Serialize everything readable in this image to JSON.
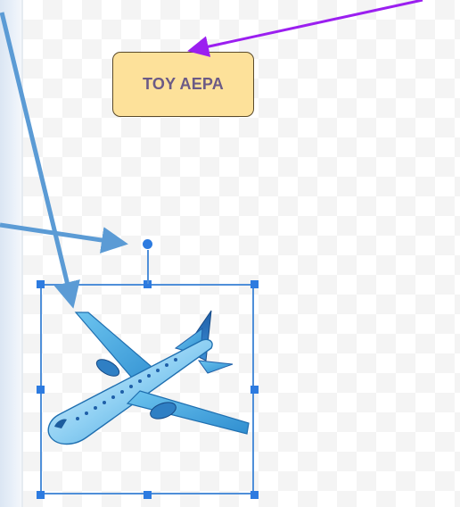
{
  "slide": {
    "label_text": "TOY AEPA"
  },
  "image": {
    "icon": "airplane-icon",
    "selected": true
  },
  "annotations": {
    "purple_arrow_color": "#9b1ff0",
    "blue_arrow_color": "#5b9bd5"
  },
  "colors": {
    "label_fill": "#fde19a",
    "label_text": "#6b5a86",
    "selection": "#4f8fd9",
    "handle": "#2d7be0"
  }
}
